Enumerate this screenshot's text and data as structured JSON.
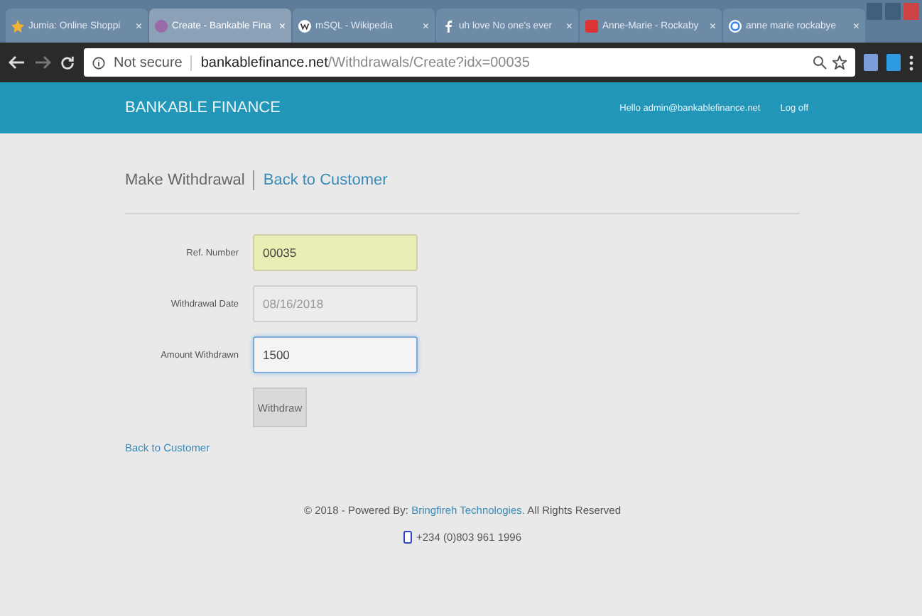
{
  "browser": {
    "tabs": [
      {
        "title": "Jumia: Online Shoppi",
        "close": "×",
        "selected": false
      },
      {
        "title": "Create - Bankable Fina",
        "close": "×",
        "selected": true
      },
      {
        "title": "mSQL - Wikipedia",
        "close": "×",
        "selected": false
      },
      {
        "title": "uh love No one's ever",
        "close": "×",
        "selected": false
      },
      {
        "title": "Anne-Marie - Rockaby",
        "close": "×",
        "selected": false
      },
      {
        "title": "anne marie rockabye",
        "close": "×",
        "selected": false
      }
    ],
    "security": "Not secure",
    "url_host": "bankablefinance.net",
    "url_path": "/Withdrawals/Create?idx=00035"
  },
  "navbar": {
    "brand": "BANKABLE FINANCE",
    "greeting": "Hello admin@bankablefinance.net",
    "logoff": "Log off"
  },
  "heading": {
    "title": "Make Withdrawal",
    "link": "Back to Customer"
  },
  "fields": [
    {
      "label": "Ref. Number",
      "value": "00035",
      "autofilled": true,
      "disabled": false,
      "focused": false
    },
    {
      "label": "Withdrawal Date",
      "value": "08/16/2018",
      "autofilled": false,
      "disabled": true,
      "focused": false
    },
    {
      "label": "Amount Withdrawn",
      "value": "1500",
      "autofilled": false,
      "disabled": false,
      "focused": true
    }
  ],
  "submit": "Withdraw",
  "back_link": "Back to Customer",
  "footer": {
    "prefix": "© 2018 - Powered By:",
    "company": "Bringfireh Technologies.",
    "suffix": "All Rights Reserved",
    "phone": "+234 (0)803 961 1996"
  }
}
